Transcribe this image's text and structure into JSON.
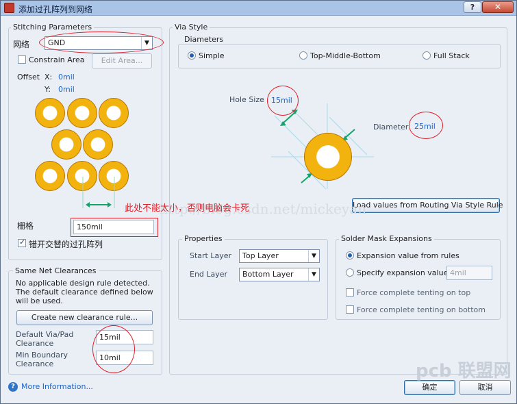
{
  "window": {
    "title": "添加过孔阵列到网络",
    "help": "?",
    "close": "✕"
  },
  "stitching": {
    "group_label": "Stitching Parameters",
    "net_label": "网络",
    "net_value": "GND",
    "constrain_label": "Constrain Area",
    "edit_area": "Edit Area...",
    "offset_label": "Offset",
    "x_label": "X:",
    "x_value": "0mil",
    "y_label": "Y:",
    "y_value": "0mil",
    "grid_label": "栅格",
    "grid_value": "150mil",
    "stagger_label": "错开交替的过孔阵列"
  },
  "via_style": {
    "group_label": "Via Style",
    "diameters_label": "Diameters",
    "simple": "Simple",
    "tmb": "Top-Middle-Bottom",
    "full_stack": "Full Stack",
    "hole_size_label": "Hole Size",
    "hole_size_value": "15mil",
    "diameter_label": "Diameter",
    "diameter_value": "25mil",
    "load_button": "Load values from Routing Via Style Rule"
  },
  "properties": {
    "group_label": "Properties",
    "start_layer_label": "Start Layer",
    "start_layer_value": "Top Layer",
    "end_layer_label": "End Layer",
    "end_layer_value": "Bottom Layer"
  },
  "solder_mask": {
    "group_label": "Solder Mask Expansions",
    "from_rules": "Expansion value from rules",
    "specify": "Specify expansion value",
    "specify_value": "4mil",
    "tent_top": "Force complete tenting on top",
    "tent_bottom": "Force complete tenting on bottom"
  },
  "clearances": {
    "group_label": "Same Net Clearances",
    "message": "No applicable design rule detected. The default clearance defined below will be used.",
    "create_button": "Create new clearance rule...",
    "default_via_label": "Default Via/Pad Clearance",
    "default_via_value": "15mil",
    "min_boundary_label": "Min Boundary Clearance",
    "min_boundary_value": "10mil"
  },
  "footer": {
    "more_info": "More Information...",
    "ok": "确定",
    "cancel": "取消"
  },
  "annotations": {
    "note": "此处不能太小，否则电脑会卡死",
    "watermark": "http://blog.csdn.net/mickeyan",
    "logo": "pcb 联盟网"
  },
  "colors": {
    "accent": "#1d63c6",
    "via": "#f2b30e",
    "annotation": "#e0202a",
    "arrow": "#16a36b"
  }
}
